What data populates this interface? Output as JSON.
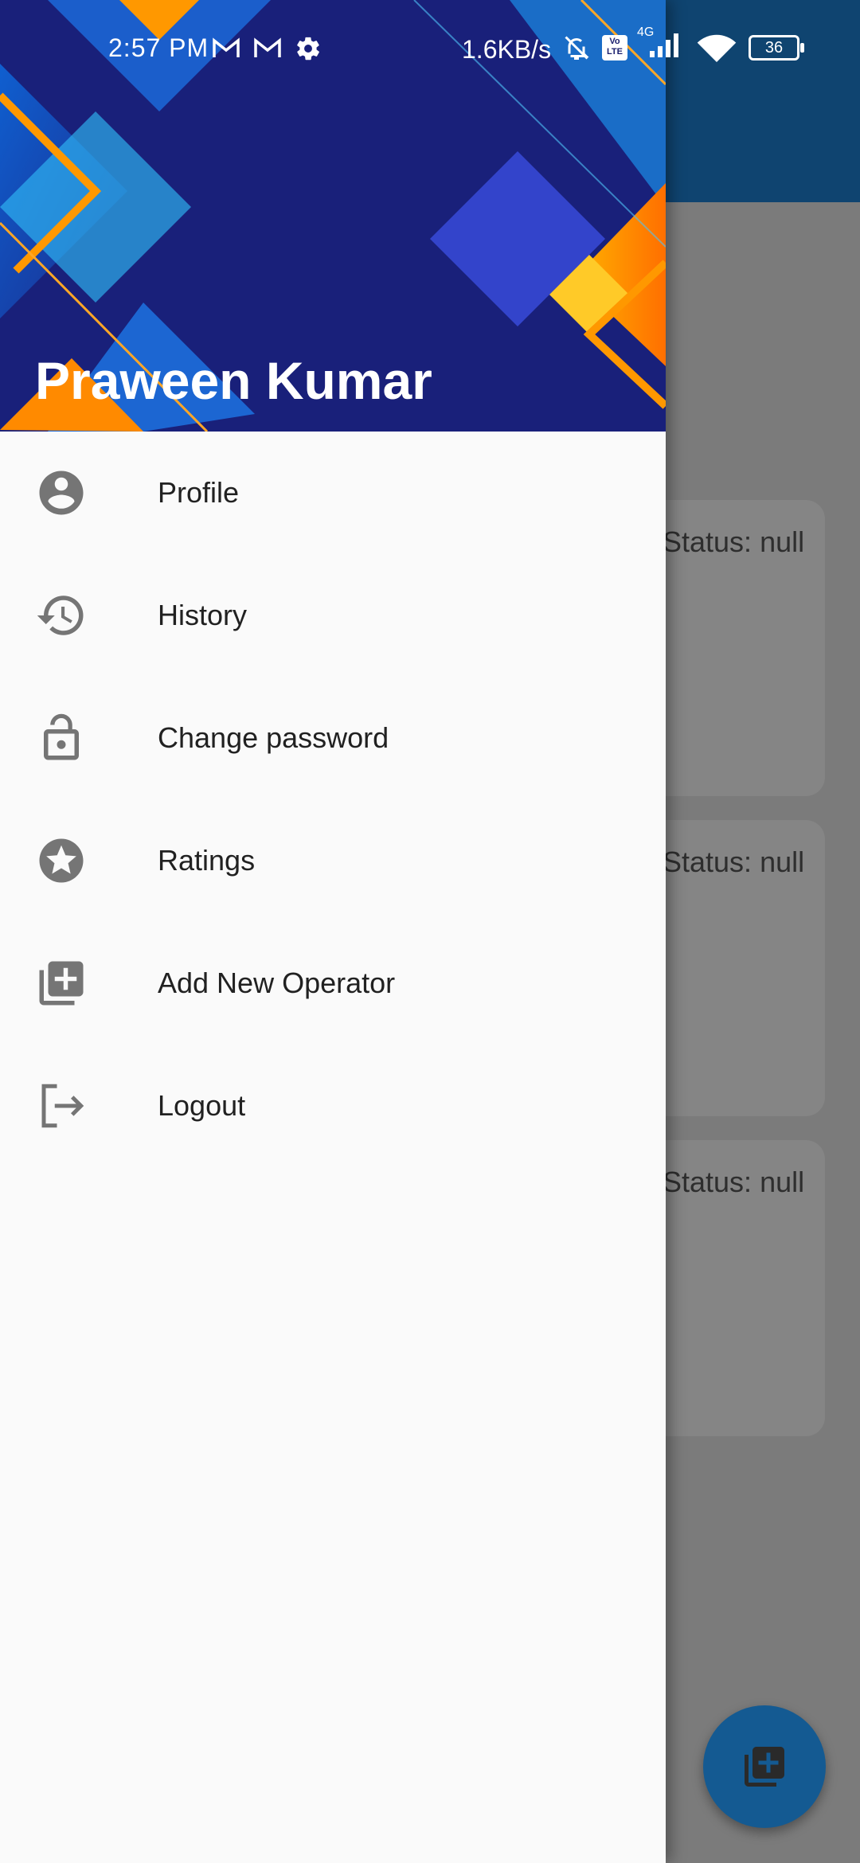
{
  "status_bar": {
    "time": "2:57 PM",
    "net_speed": "1.6KB/s",
    "network_type": "4G",
    "volte_label": "Vo LTE",
    "battery": "36",
    "icons": [
      "gmail-icon",
      "gmail-icon",
      "settings-icon",
      "mute-icon",
      "volte-icon",
      "signal-icon",
      "wifi-icon",
      "battery-icon"
    ]
  },
  "drawer": {
    "user_name": "Praween Kumar",
    "items": [
      {
        "label": "Profile",
        "icon": "account-circle-icon"
      },
      {
        "label": "History",
        "icon": "history-icon"
      },
      {
        "label": "Change password",
        "icon": "lock-open-icon"
      },
      {
        "label": "Ratings",
        "icon": "star-circle-icon"
      },
      {
        "label": "Add New Operator",
        "icon": "library-add-icon"
      },
      {
        "label": "Logout",
        "icon": "logout-icon"
      }
    ]
  },
  "background": {
    "cards": [
      {
        "status_text": "Status: null"
      },
      {
        "status_text": "Status: null"
      },
      {
        "status_text": "Status: null"
      }
    ],
    "fab_icon": "library-add-icon"
  },
  "colors": {
    "app_bar": "#0f4470",
    "fab": "#145a92",
    "drawer_bg": "#fafafa",
    "icon_gray": "#757575",
    "scrim": "#7a7a7a"
  }
}
